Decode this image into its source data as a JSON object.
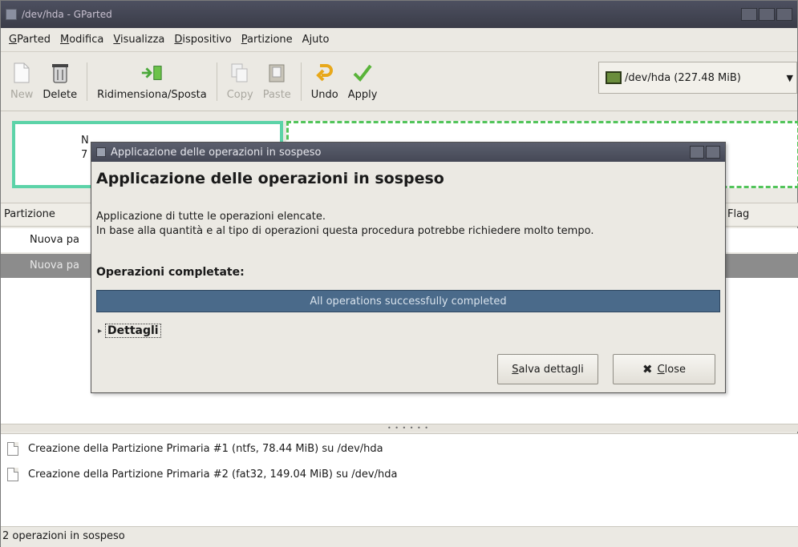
{
  "window": {
    "title": "/dev/hda - GParted"
  },
  "menu": {
    "items": [
      {
        "ul": "G",
        "rest": "Parted"
      },
      {
        "ul": "M",
        "rest": "odifica"
      },
      {
        "ul": "V",
        "rest": "isualizza"
      },
      {
        "ul": "D",
        "rest": "ispositivo"
      },
      {
        "ul": "P",
        "rest": "artizione"
      },
      {
        "ul": "",
        "rest": "Ajuto"
      }
    ]
  },
  "toolbar": {
    "new": "New",
    "delete": "Delete",
    "resize": "Ridimensiona/Sposta",
    "copy": "Copy",
    "paste": "Paste",
    "undo": "Undo",
    "apply": "Apply",
    "device": "/dev/hda  (227.48 MiB)"
  },
  "partition_map": {
    "box1_line1": "N",
    "box1_line2": "7"
  },
  "partition_table": {
    "col_partition": "Partizione",
    "col_flag": "Flag",
    "rows": [
      "Nuova pa",
      "Nuova pa"
    ]
  },
  "pending": {
    "ops": [
      "Creazione della Partizione Primaria #1 (ntfs, 78.44 MiB) su /dev/hda",
      "Creazione della Partizione Primaria #2 (fat32, 149.04 MiB) su /dev/hda"
    ],
    "status": "2 operazioni in sospeso"
  },
  "dialog": {
    "title": "Applicazione delle operazioni in sospeso",
    "heading": "Applicazione delle operazioni in sospeso",
    "desc_line1": "Applicazione di tutte le operazioni elencate.",
    "desc_line2": "In base alla quantità e al tipo di operazioni questa procedura potrebbe richiedere molto tempo.",
    "completed_label": "Operazioni completate:",
    "progress_text": "All operations successfully completed",
    "progress_fraction": 1.0,
    "details_label": "Dettagli",
    "save_button_ul": "S",
    "save_button_rest": "alva dettagli",
    "close_button_ul": "C",
    "close_button_rest": "lose"
  },
  "colors": {
    "progress_fill": "#4a6a8a",
    "selected_row": "#8c8c8c",
    "partition1_border": "#5cd3a8",
    "partition2_border": "#52c45a"
  }
}
